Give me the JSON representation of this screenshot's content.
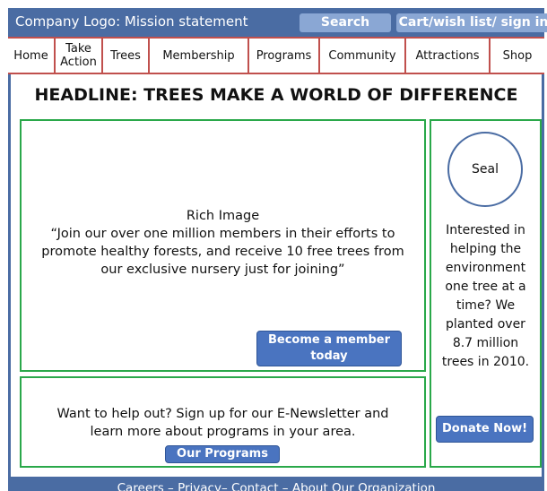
{
  "header": {
    "logo_text": "Company Logo: Mission statement",
    "search_label": "Search",
    "cart_label": "Cart/wish list/ sign in"
  },
  "nav": {
    "items": [
      {
        "label": "Home"
      },
      {
        "label": "Take\nAction"
      },
      {
        "label": "Trees"
      },
      {
        "label": "Membership"
      },
      {
        "label": "Programs"
      },
      {
        "label": "Community"
      },
      {
        "label": "Attractions"
      },
      {
        "label": "Shop"
      }
    ]
  },
  "headline": "HEADLINE: TREES MAKE A WORLD OF DIFFERENCE",
  "rich": {
    "title": "Rich Image",
    "quote_line1": "“Join our over one million members in their efforts to",
    "quote_line2": "promote healthy forests, and receive 10 free trees from",
    "quote_line3": "our exclusive nursery just for joining”",
    "button_line1": "Become a member",
    "button_line2": "today"
  },
  "newsletter": {
    "line1": "Want to help out? Sign up for our E-Newsletter and",
    "line2": "learn more about programs in your area.",
    "button": "Our Programs"
  },
  "side": {
    "seal": "Seal",
    "lines": [
      "Interested in",
      "helping the",
      "environment",
      "one tree at a",
      "time?  We",
      "planted over",
      "8.7 million",
      "trees in 2010."
    ],
    "donate": "Donate Now!"
  },
  "footer": "Careers – Privacy– Contact – About Our Organization",
  "colors": {
    "primary_blue": "#4a6ca3",
    "nav_border_red": "#c0504d",
    "box_border_green": "#2aa84a",
    "button_blue": "#4a74c0",
    "light_button": "#8aa7d4"
  }
}
